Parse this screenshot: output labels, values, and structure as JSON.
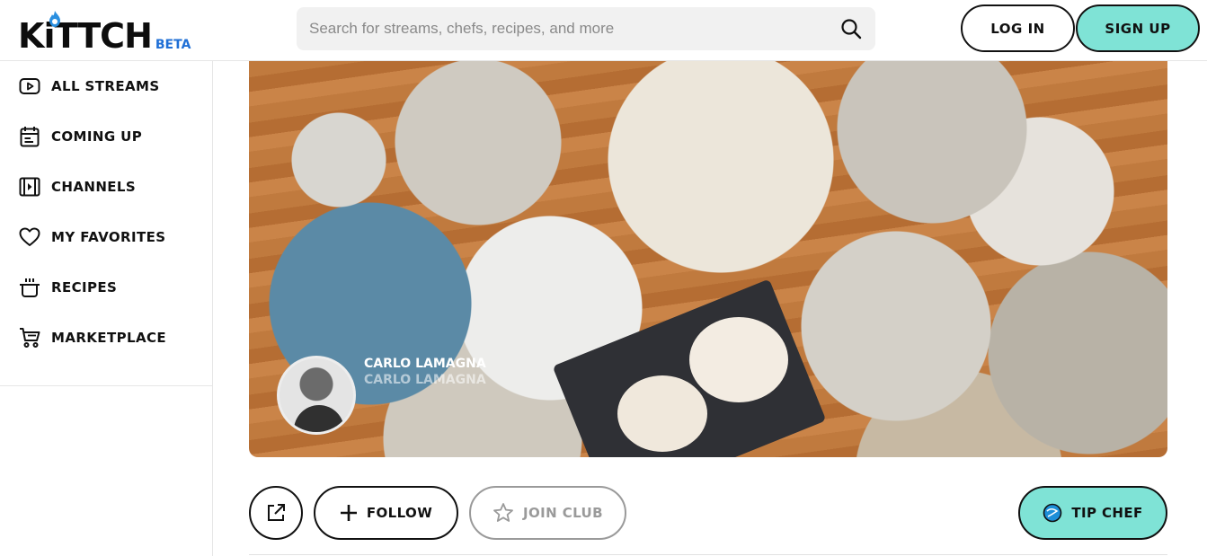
{
  "brand": {
    "name": "KiTTCH",
    "badge": "BETA",
    "colors": {
      "badge": "#1f6fd6",
      "accent": "#7fe3d6",
      "flame": "#2a8fe0"
    }
  },
  "search": {
    "placeholder": "Search for streams, chefs, recipes, and more",
    "icon": "search-icon"
  },
  "auth": {
    "login_label": "LOG IN",
    "signup_label": "SIGN UP"
  },
  "sidebar": {
    "items": [
      {
        "label": "ALL STREAMS",
        "icon": "play-icon"
      },
      {
        "label": "COMING UP",
        "icon": "calendar-icon"
      },
      {
        "label": "CHANNELS",
        "icon": "channels-icon"
      },
      {
        "label": "MY FAVORITES",
        "icon": "heart-icon"
      },
      {
        "label": "RECIPES",
        "icon": "pot-icon"
      },
      {
        "label": "MARKETPLACE",
        "icon": "cart-icon"
      }
    ]
  },
  "hero": {
    "chef_name": "CARLO LAMAGNA",
    "chef_handle": "CARLO LAMAGNA"
  },
  "actions": {
    "share_icon": "share-icon",
    "follow_label": "FOLLOW",
    "join_label": "JOIN CLUB",
    "tip_label": "TIP CHEF"
  }
}
